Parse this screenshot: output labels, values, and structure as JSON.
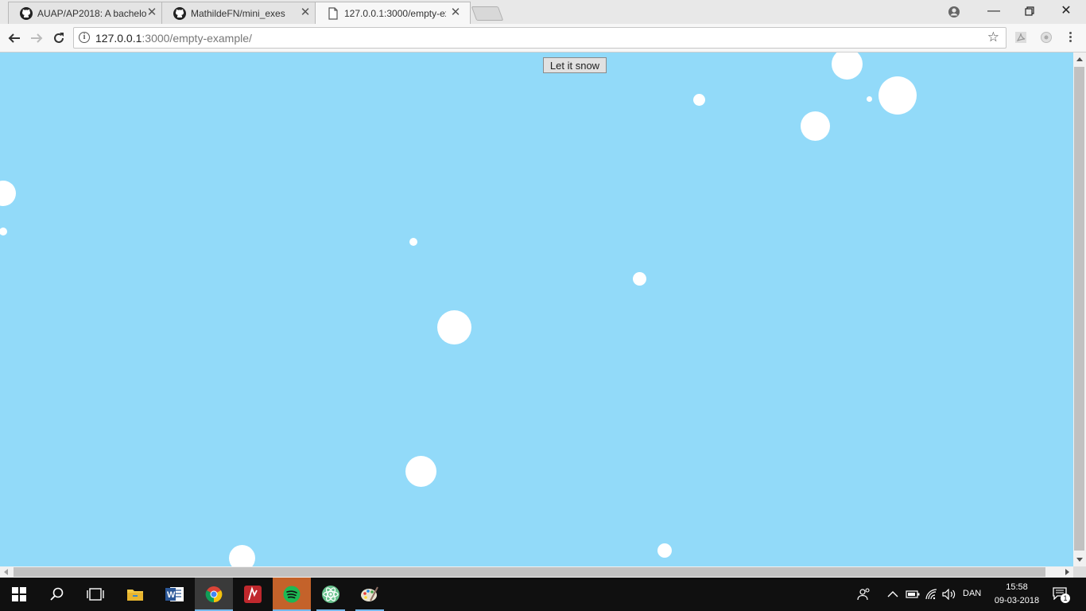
{
  "browser": {
    "tabs": [
      {
        "title": "AUAP/AP2018: A bachelo",
        "icon": "github-icon",
        "active": false
      },
      {
        "title": "MathildeFN/mini_exes",
        "icon": "github-icon",
        "active": false
      },
      {
        "title": "127.0.0.1:3000/empty-ex",
        "icon": "page-icon",
        "active": true
      }
    ],
    "address": {
      "host": "127.0.0.1",
      "path": ":3000/empty-example/"
    }
  },
  "page": {
    "button_label": "Let it snow",
    "background_color": "#92daf9",
    "snowflake_color": "#ffffff"
  },
  "taskbar": {
    "apps": [
      "start-icon",
      "search-icon",
      "task-view-icon",
      "file-explorer-icon",
      "word-icon",
      "chrome-icon",
      "app-red-icon",
      "spotify-icon",
      "atom-icon",
      "paint-icon"
    ],
    "language": "DAN",
    "time": "15:58",
    "date": "09-03-2018",
    "notification_count": "1"
  }
}
